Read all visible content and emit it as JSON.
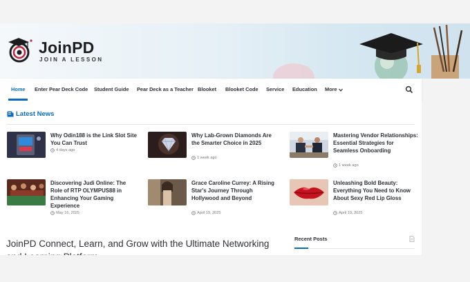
{
  "brand": {
    "title": "JoinPD",
    "tagline": "JOIN A LESSON"
  },
  "nav": {
    "items": [
      {
        "label": "Home"
      },
      {
        "label": "Enter Pear Deck Code"
      },
      {
        "label": "Student Guide"
      },
      {
        "label": "Pear Deck as a Teacher"
      },
      {
        "label": "Blooket"
      },
      {
        "label": "Blooket Code"
      },
      {
        "label": "Service"
      },
      {
        "label": "Education"
      },
      {
        "label": "More"
      }
    ],
    "active_color": "#0a6bc2"
  },
  "latest_news": {
    "heading": "Latest News",
    "posts": [
      {
        "title": "Why Odin188 is the Link Slot Site You Can Trust",
        "date": "4 days ago",
        "thumb": "slot-machine"
      },
      {
        "title": "Why Lab-Grown Diamonds Are the Smarter Choice in 2025",
        "date": "1 week ago",
        "thumb": "diamond"
      },
      {
        "title": "Mastering Vendor Relationships: Essential Strategies for Seamless Onboarding",
        "date": "1 week ago",
        "thumb": "handshake"
      },
      {
        "title": "Discovering Judi Online: The Role of RTP OLYMPUS88 in Enhancing Your Gaming Experience",
        "date": "May 16, 2025",
        "thumb": "casino-players"
      },
      {
        "title": "Grace Caroline Currey: A Rising Star's Journey Through Hollywood and Beyond",
        "date": "April 19, 2025",
        "thumb": "portrait"
      },
      {
        "title": "Unleashing Bold Beauty: Everything You Need to Know About Sexy Red Lip Gloss",
        "date": "April 19, 2025",
        "thumb": "red-lips"
      }
    ]
  },
  "article": {
    "heading": "JoinPD Connect, Learn, and Grow with the Ultimate Networking and Learning Platform"
  },
  "sidebar": {
    "recent_posts_title": "Recent Posts"
  }
}
